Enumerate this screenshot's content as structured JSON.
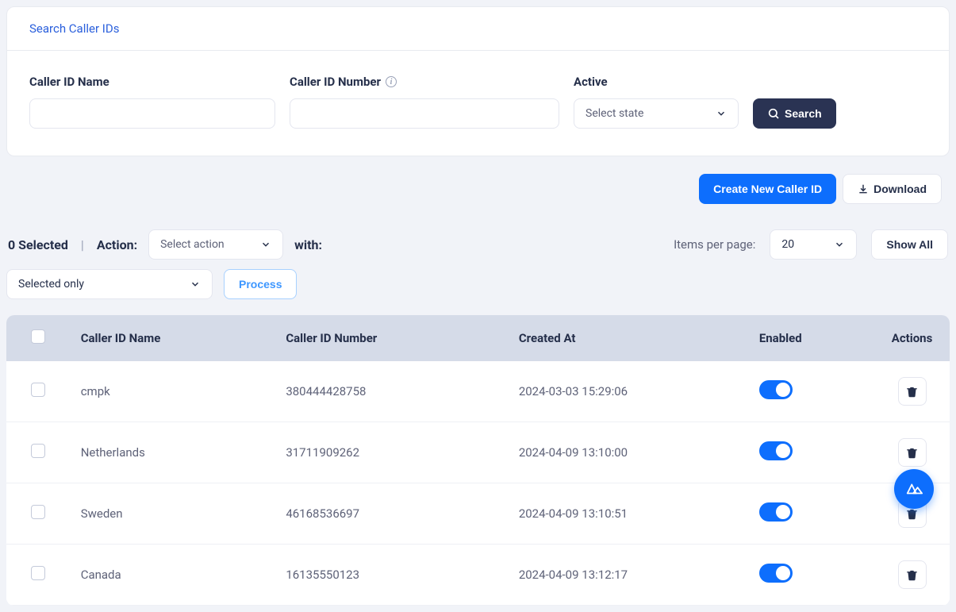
{
  "search": {
    "title": "Search Caller IDs",
    "fields": {
      "name_label": "Caller ID Name",
      "number_label": "Caller ID Number",
      "active_label": "Active",
      "active_placeholder": "Select state"
    },
    "search_btn": "Search"
  },
  "actions_bar": {
    "create_btn": "Create New Caller ID",
    "download_btn": "Download"
  },
  "bulk": {
    "selected_count": "0 Selected",
    "action_label": "Action:",
    "action_placeholder": "Select action",
    "with_label": "with:",
    "scope_placeholder": "Selected only",
    "process_btn": "Process"
  },
  "pagination": {
    "ipp_label": "Items per page:",
    "ipp_value": "20",
    "show_all": "Show All"
  },
  "table": {
    "headers": {
      "name": "Caller ID Name",
      "number": "Caller ID Number",
      "created": "Created At",
      "enabled": "Enabled",
      "actions": "Actions"
    },
    "rows": [
      {
        "name": "cmpk",
        "number": "380444428758",
        "created": "2024-03-03 15:29:06",
        "enabled": true
      },
      {
        "name": "Netherlands",
        "number": "31711909262",
        "created": "2024-04-09 13:10:00",
        "enabled": true
      },
      {
        "name": "Sweden",
        "number": "46168536697",
        "created": "2024-04-09 13:10:51",
        "enabled": true
      },
      {
        "name": "Canada",
        "number": "16135550123",
        "created": "2024-04-09 13:12:17",
        "enabled": true
      }
    ]
  }
}
